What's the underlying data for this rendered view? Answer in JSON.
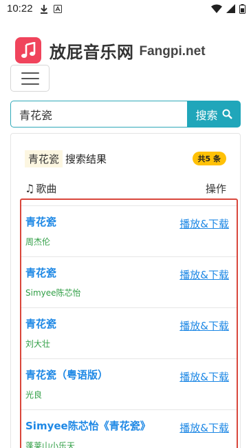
{
  "status_bar": {
    "time": "10:22"
  },
  "header": {
    "title": "放屁音乐网",
    "domain": "Fangpi.net"
  },
  "search": {
    "value": "青花瓷",
    "button_label": "搜索"
  },
  "results": {
    "query": "青花瓷",
    "title": "搜索结果",
    "count": "共5 条",
    "col_song": "歌曲",
    "col_action": "操作",
    "items": [
      {
        "title": "青花瓷",
        "artist": "周杰伦",
        "action": "播放&下载"
      },
      {
        "title": "青花瓷",
        "artist": "Simyee陈芯怡",
        "action": "播放&下载"
      },
      {
        "title": "青花瓷",
        "artist": "刘大壮",
        "action": "播放&下载"
      },
      {
        "title": "青花瓷（粤语版）",
        "artist": "光良",
        "action": "播放&下载"
      },
      {
        "title": "Simyee陈芯怡《青花瓷》",
        "artist": "蓬莱山小乐天",
        "action": "播放&下载"
      }
    ]
  },
  "icons": {
    "logo": "music-note-icon",
    "search": "magnifier-icon",
    "menu": "hamburger-icon"
  },
  "colors": {
    "accent": "#20a6ba",
    "logo_bg": "#f0445c",
    "link": "#1e88e5",
    "artist": "#2f9e44",
    "badge": "#ffc107",
    "highlight_border": "#d9463b"
  }
}
